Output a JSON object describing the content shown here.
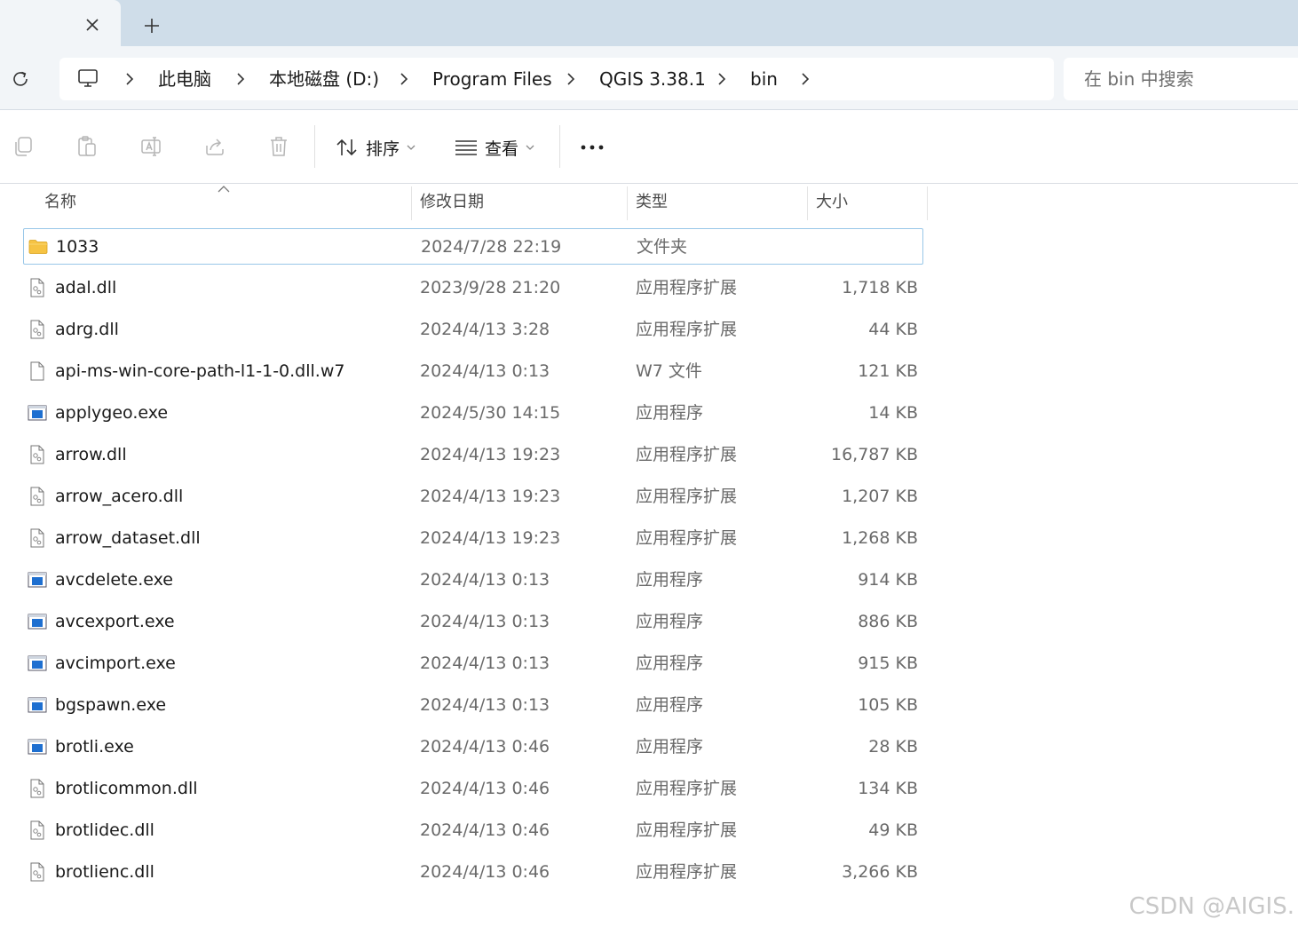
{
  "tabs": {
    "new_tab_label": "+"
  },
  "address": {
    "breadcrumbs": [
      "此电脑",
      "本地磁盘 (D:)",
      "Program Files",
      "QGIS 3.38.1",
      "bin"
    ],
    "search_placeholder": "在 bin 中搜索"
  },
  "toolbar": {
    "sort_label": "排序",
    "view_label": "查看"
  },
  "columns": {
    "name": "名称",
    "date": "修改日期",
    "type": "类型",
    "size": "大小"
  },
  "files": [
    {
      "name": "1033",
      "date": "2024/7/28 22:19",
      "type": "文件夹",
      "size": "",
      "icon": "folder-icon"
    },
    {
      "name": "adal.dll",
      "date": "2023/9/28 21:20",
      "type": "应用程序扩展",
      "size": "1,718 KB",
      "icon": "dll-file-icon"
    },
    {
      "name": "adrg.dll",
      "date": "2024/4/13 3:28",
      "type": "应用程序扩展",
      "size": "44 KB",
      "icon": "dll-file-icon"
    },
    {
      "name": "api-ms-win-core-path-l1-1-0.dll.w7",
      "date": "2024/4/13 0:13",
      "type": "W7 文件",
      "size": "121 KB",
      "icon": "blank-file-icon"
    },
    {
      "name": "applygeo.exe",
      "date": "2024/5/30 14:15",
      "type": "应用程序",
      "size": "14 KB",
      "icon": "exe-file-icon"
    },
    {
      "name": "arrow.dll",
      "date": "2024/4/13 19:23",
      "type": "应用程序扩展",
      "size": "16,787 KB",
      "icon": "dll-file-icon"
    },
    {
      "name": "arrow_acero.dll",
      "date": "2024/4/13 19:23",
      "type": "应用程序扩展",
      "size": "1,207 KB",
      "icon": "dll-file-icon"
    },
    {
      "name": "arrow_dataset.dll",
      "date": "2024/4/13 19:23",
      "type": "应用程序扩展",
      "size": "1,268 KB",
      "icon": "dll-file-icon"
    },
    {
      "name": "avcdelete.exe",
      "date": "2024/4/13 0:13",
      "type": "应用程序",
      "size": "914 KB",
      "icon": "exe-file-icon"
    },
    {
      "name": "avcexport.exe",
      "date": "2024/4/13 0:13",
      "type": "应用程序",
      "size": "886 KB",
      "icon": "exe-file-icon"
    },
    {
      "name": "avcimport.exe",
      "date": "2024/4/13 0:13",
      "type": "应用程序",
      "size": "915 KB",
      "icon": "exe-file-icon"
    },
    {
      "name": "bgspawn.exe",
      "date": "2024/4/13 0:13",
      "type": "应用程序",
      "size": "105 KB",
      "icon": "exe-file-icon"
    },
    {
      "name": "brotli.exe",
      "date": "2024/4/13 0:46",
      "type": "应用程序",
      "size": "28 KB",
      "icon": "exe-file-icon"
    },
    {
      "name": "brotlicommon.dll",
      "date": "2024/4/13 0:46",
      "type": "应用程序扩展",
      "size": "134 KB",
      "icon": "dll-file-icon"
    },
    {
      "name": "brotlidec.dll",
      "date": "2024/4/13 0:46",
      "type": "应用程序扩展",
      "size": "49 KB",
      "icon": "dll-file-icon"
    },
    {
      "name": "brotlienc.dll",
      "date": "2024/4/13 0:46",
      "type": "应用程序扩展",
      "size": "3,266 KB",
      "icon": "dll-file-icon"
    }
  ],
  "watermark": "CSDN @AIGIS.",
  "colors": {
    "selection_border": "#99c7e8",
    "tabstrip": "#cfdde9",
    "exe_blue": "#1e6fd0",
    "folder_yellow": "#f6c343"
  }
}
